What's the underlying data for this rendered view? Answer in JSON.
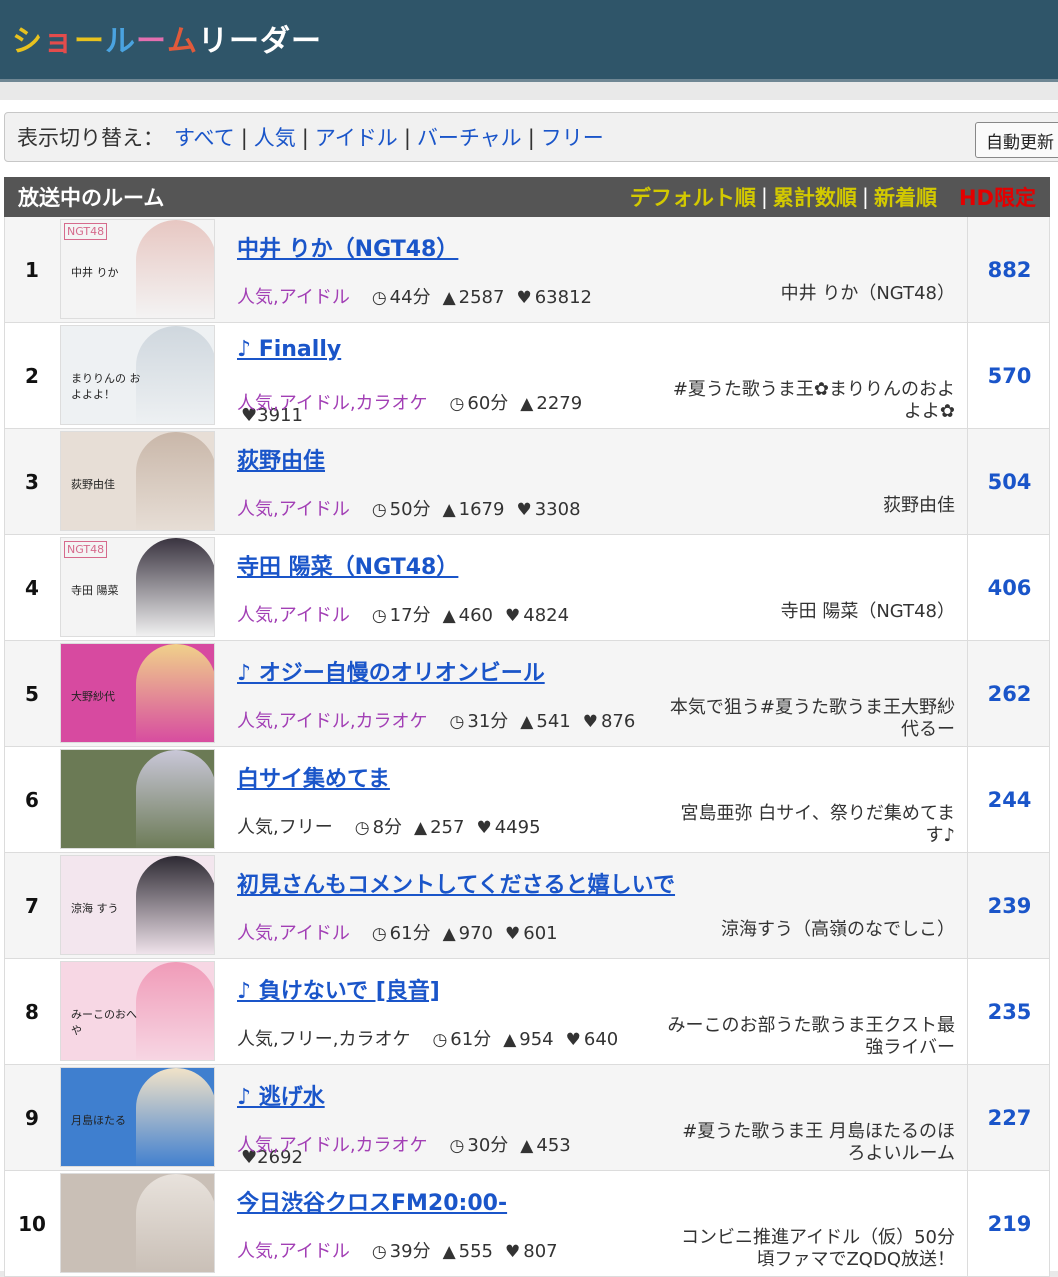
{
  "header": {
    "logo_chars": [
      {
        "ch": "シ",
        "color": "#e8c21e"
      },
      {
        "ch": "ョ",
        "color": "#e34c4c"
      },
      {
        "ch": "ー",
        "color": "#e8c21e"
      },
      {
        "ch": "ル",
        "color": "#4aa3e0"
      },
      {
        "ch": "ー",
        "color": "#e36fb0"
      },
      {
        "ch": "ム",
        "color": "#e05a3b"
      },
      {
        "ch": " リーダー",
        "color": "#ffffff"
      }
    ]
  },
  "switch": {
    "label": "表示切り替え：",
    "links": [
      "すべて",
      "人気",
      "アイドル",
      "バーチャル",
      "フリー"
    ],
    "separator": "|",
    "auto_update": "自動更新"
  },
  "list": {
    "title": "放送中のルーム",
    "sorts": [
      "デフォルト順",
      "累計数順",
      "新着順"
    ],
    "hd": "HD限定"
  },
  "icons": {
    "clock": "clock-icon",
    "user": "user-icon",
    "heart": "heart-icon"
  },
  "rows": [
    {
      "rank": "1",
      "title": "中井 りか（NGT48）",
      "genre": "人気,アイドル",
      "genre_color": "#a23fb5",
      "time": "44分",
      "viewers": "2587",
      "hearts": "63812",
      "owner": "中井 りか（NGT48）",
      "count": "882",
      "thumb_caption": "中井 りか",
      "thumb_logo": "NGT48"
    },
    {
      "rank": "2",
      "title": "♪ Finally",
      "genre": "人気,アイドル,カラオケ",
      "genre_color": "#a23fb5",
      "time": "60分",
      "viewers": "2279",
      "hearts": "3911",
      "owner": "#夏うた歌うま王✿まりりんのおよよよ✿",
      "count": "570",
      "thumb_caption": "まりりんの およよよ！",
      "thumb_logo": ""
    },
    {
      "rank": "3",
      "title": "荻野由佳",
      "genre": "人気,アイドル",
      "genre_color": "#a23fb5",
      "time": "50分",
      "viewers": "1679",
      "hearts": "3308",
      "owner": "荻野由佳",
      "count": "504",
      "thumb_caption": "荻野由佳",
      "thumb_logo": ""
    },
    {
      "rank": "4",
      "title": "寺田 陽菜（NGT48）",
      "genre": "人気,アイドル",
      "genre_color": "#a23fb5",
      "time": "17分",
      "viewers": "460",
      "hearts": "4824",
      "owner": "寺田 陽菜（NGT48）",
      "count": "406",
      "thumb_caption": "寺田 陽菜",
      "thumb_logo": "NGT48"
    },
    {
      "rank": "5",
      "title": "♪ オジー自慢のオリオンビール",
      "genre": "人気,アイドル,カラオケ",
      "genre_color": "#a23fb5",
      "time": "31分",
      "viewers": "541",
      "hearts": "876",
      "owner": "本気で狙う#夏うた歌うま王大野紗代るー",
      "count": "262",
      "thumb_caption": "大野紗代",
      "thumb_logo": ""
    },
    {
      "rank": "6",
      "title": "白サイ集めてま",
      "genre": "人気,フリー",
      "genre_color": "#333333",
      "time": "8分",
      "viewers": "257",
      "hearts": "4495",
      "owner": "宮島亜弥 白サイ、祭りだ集めてます♪",
      "count": "244",
      "thumb_caption": "",
      "thumb_logo": ""
    },
    {
      "rank": "7",
      "title": "初見さんもコメントしてくださると嬉しいで",
      "genre": "人気,アイドル",
      "genre_color": "#a23fb5",
      "time": "61分",
      "viewers": "970",
      "hearts": "601",
      "owner": "涼海すう（高嶺のなでしこ）",
      "count": "239",
      "thumb_caption": "涼海 すう",
      "thumb_logo": ""
    },
    {
      "rank": "8",
      "title": "♪ 負けないで [良音]",
      "genre": "人気,フリー,カラオケ",
      "genre_color": "#333333",
      "time": "61分",
      "viewers": "954",
      "hearts": "640",
      "owner": "みーこのお部うた歌うま王クスト最強ライバー",
      "count": "235",
      "thumb_caption": "みーこのおへや",
      "thumb_logo": ""
    },
    {
      "rank": "9",
      "title": "♪ 逃げ水",
      "genre": "人気,アイドル,カラオケ",
      "genre_color": "#a23fb5",
      "time": "30分",
      "viewers": "453",
      "hearts": "2692",
      "owner": "#夏うた歌うま王 月島ほたるのほろよいルーム",
      "count": "227",
      "thumb_caption": "月島ほたる",
      "thumb_logo": ""
    },
    {
      "rank": "10",
      "title": "今日渋谷クロスFM20:00-",
      "genre": "人気,アイドル",
      "genre_color": "#a23fb5",
      "time": "39分",
      "viewers": "555",
      "hearts": "807",
      "owner": "コンビニ推進アイドル（仮）50分頃ファマでZQDQ放送！",
      "count": "219",
      "thumb_caption": "",
      "thumb_logo": ""
    }
  ]
}
